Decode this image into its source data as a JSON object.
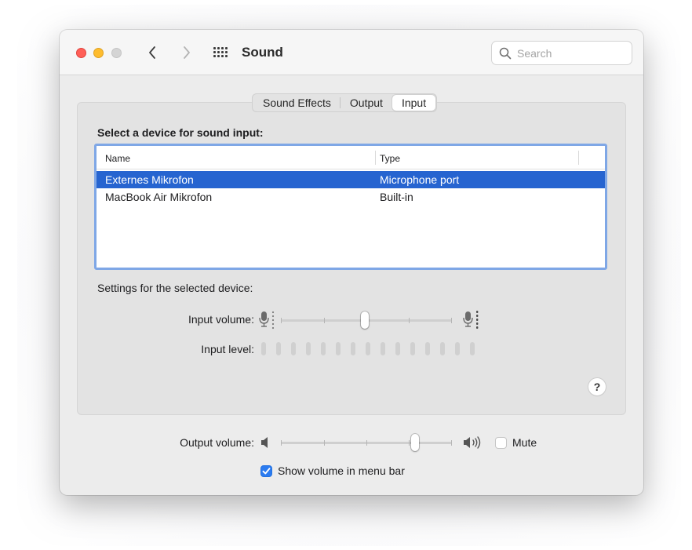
{
  "window": {
    "title": "Sound",
    "search_placeholder": "Search"
  },
  "icons": {
    "back": "chevron-left-icon",
    "forward": "chevron-right-icon",
    "grid": "grid-icon",
    "search": "search-icon",
    "mic_low": "microphone-low-icon",
    "mic_high": "microphone-high-icon",
    "speaker_low": "speaker-low-icon",
    "speaker_high": "speaker-high-icon",
    "checkmark": "checkmark-icon"
  },
  "tabs": [
    {
      "label": "Sound Effects",
      "selected": false
    },
    {
      "label": "Output",
      "selected": false
    },
    {
      "label": "Input",
      "selected": true
    }
  ],
  "input": {
    "heading": "Select a device for sound input:",
    "columns": [
      "Name",
      "Type"
    ],
    "devices": [
      {
        "name": "Externes Mikrofon",
        "type": "Microphone port",
        "selected": true
      },
      {
        "name": "MacBook Air Mikrofon",
        "type": "Built-in",
        "selected": false
      }
    ],
    "settings_label": "Settings for the selected device:",
    "volume_label": "Input volume:",
    "volume_level": 0.5,
    "level_label": "Input level:",
    "level_segments": 15,
    "level_active": 0,
    "help_label": "?"
  },
  "output": {
    "volume_label": "Output volume:",
    "volume_level": 0.8,
    "mute_label": "Mute",
    "mute_checked": false,
    "show_volume_label": "Show volume in menu bar",
    "show_volume_checked": true
  },
  "colors": {
    "accent": "#2b7bf0",
    "selection": "#2664d0",
    "close": "#ff5f57",
    "minimize": "#febc2e"
  }
}
